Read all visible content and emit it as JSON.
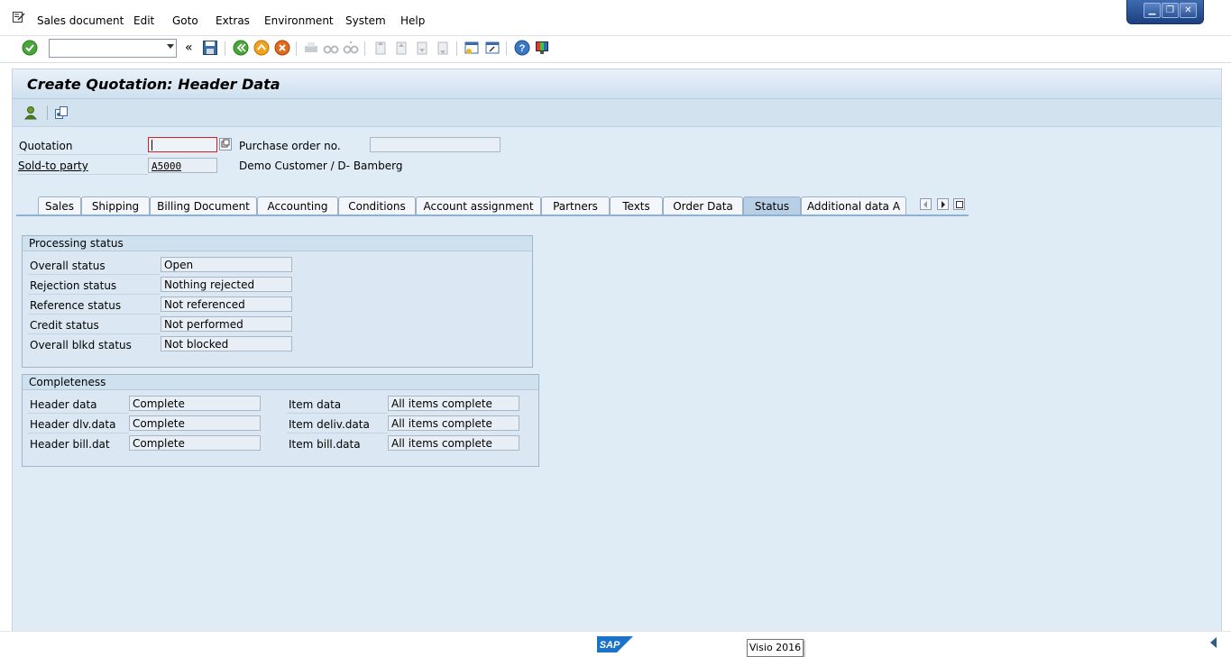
{
  "menubar": {
    "items": [
      "Sales document",
      "Edit",
      "Goto",
      "Extras",
      "Environment",
      "System",
      "Help"
    ]
  },
  "window_controls": {
    "minimize": "▁",
    "restore": "❐",
    "close": "✕"
  },
  "toolbar": {
    "command_field_value": "",
    "history_glyph": "«"
  },
  "screen": {
    "title": "Create Quotation: Header Data"
  },
  "header": {
    "quotation_label": "Quotation",
    "quotation_value": "",
    "po_label": "Purchase order no.",
    "po_value": "",
    "sold_to_label": "Sold-to party",
    "sold_to_value": "A5000",
    "sold_to_text": "Demo Customer / D- Bamberg"
  },
  "tabs": [
    {
      "label": "Sales"
    },
    {
      "label": "Shipping"
    },
    {
      "label": "Billing Document"
    },
    {
      "label": "Accounting"
    },
    {
      "label": "Conditions"
    },
    {
      "label": "Account assignment"
    },
    {
      "label": "Partners"
    },
    {
      "label": "Texts"
    },
    {
      "label": "Order Data"
    },
    {
      "label": "Status"
    },
    {
      "label": "Additional data A"
    }
  ],
  "active_tab": "Status",
  "processing_status": {
    "title": "Processing status",
    "rows": [
      {
        "label": "Overall status",
        "value": "Open"
      },
      {
        "label": "Rejection status",
        "value": "Nothing rejected"
      },
      {
        "label": "Reference status",
        "value": "Not referenced"
      },
      {
        "label": "Credit status",
        "value": "Not performed"
      },
      {
        "label": "Overall blkd status",
        "value": "Not blocked"
      }
    ]
  },
  "completeness": {
    "title": "Completeness",
    "left": [
      {
        "label": "Header data",
        "value": "Complete"
      },
      {
        "label": "Header dlv.data",
        "value": "Complete"
      },
      {
        "label": "Header bill.dat",
        "value": "Complete"
      }
    ],
    "right": [
      {
        "label": "Item data",
        "value": "All items complete"
      },
      {
        "label": "Item deliv.data",
        "value": "All items complete"
      },
      {
        "label": "Item bill.data",
        "value": "All items complete"
      }
    ]
  },
  "statusbar": {
    "logo": "SAP",
    "tooltip": "Visio 2016"
  },
  "colors": {
    "accent": "#2f5a8a",
    "background": "#dfebf5"
  }
}
